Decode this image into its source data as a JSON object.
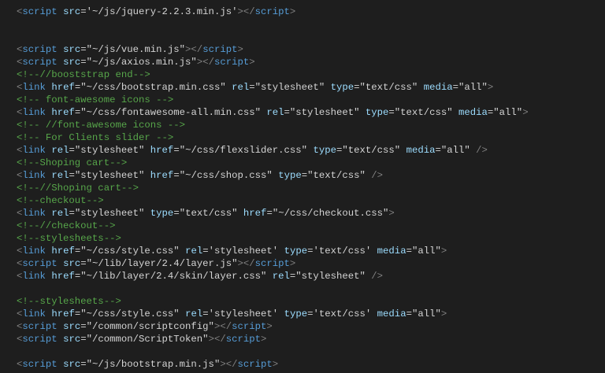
{
  "editor": {
    "colors": {
      "background": "#1e1e1e",
      "delimiter": "#808080",
      "tag": "#569cd6",
      "attribute": "#9cdcfe",
      "value": "#d4d4d4",
      "comment": "#57a64a"
    },
    "lines": [
      [
        [
          "d",
          "<"
        ],
        [
          "t",
          "script"
        ],
        [
          "p",
          " "
        ],
        [
          "a",
          "src"
        ],
        [
          "p",
          "="
        ],
        [
          "v",
          "'~/js/jquery-2.2.3.min.js'"
        ],
        [
          "d",
          "></"
        ],
        [
          "t",
          "script"
        ],
        [
          "d",
          ">"
        ]
      ],
      [],
      [],
      [
        [
          "d",
          "<"
        ],
        [
          "t",
          "script"
        ],
        [
          "p",
          " "
        ],
        [
          "a",
          "src"
        ],
        [
          "p",
          "="
        ],
        [
          "v",
          "\"~/js/vue.min.js\""
        ],
        [
          "d",
          "></"
        ],
        [
          "t",
          "script"
        ],
        [
          "d",
          ">"
        ]
      ],
      [
        [
          "d",
          "<"
        ],
        [
          "t",
          "script"
        ],
        [
          "p",
          " "
        ],
        [
          "a",
          "src"
        ],
        [
          "p",
          "="
        ],
        [
          "v",
          "\"~/js/axios.min.js\""
        ],
        [
          "d",
          "></"
        ],
        [
          "t",
          "script"
        ],
        [
          "d",
          ">"
        ]
      ],
      [
        [
          "c",
          "<!--//booststrap end-->"
        ]
      ],
      [
        [
          "d",
          "<"
        ],
        [
          "t",
          "link"
        ],
        [
          "p",
          " "
        ],
        [
          "a",
          "href"
        ],
        [
          "p",
          "="
        ],
        [
          "v",
          "\"~/css/bootstrap.min.css\""
        ],
        [
          "p",
          " "
        ],
        [
          "a",
          "rel"
        ],
        [
          "p",
          "="
        ],
        [
          "v",
          "\"stylesheet\""
        ],
        [
          "p",
          " "
        ],
        [
          "a",
          "type"
        ],
        [
          "p",
          "="
        ],
        [
          "v",
          "\"text/css\""
        ],
        [
          "p",
          " "
        ],
        [
          "a",
          "media"
        ],
        [
          "p",
          "="
        ],
        [
          "v",
          "\"all\""
        ],
        [
          "d",
          ">"
        ]
      ],
      [
        [
          "c",
          "<!-- font-awesome icons -->"
        ]
      ],
      [
        [
          "d",
          "<"
        ],
        [
          "t",
          "link"
        ],
        [
          "p",
          " "
        ],
        [
          "a",
          "href"
        ],
        [
          "p",
          "="
        ],
        [
          "v",
          "\"~/css/fontawesome-all.min.css\""
        ],
        [
          "p",
          " "
        ],
        [
          "a",
          "rel"
        ],
        [
          "p",
          "="
        ],
        [
          "v",
          "\"stylesheet\""
        ],
        [
          "p",
          " "
        ],
        [
          "a",
          "type"
        ],
        [
          "p",
          "="
        ],
        [
          "v",
          "\"text/css\""
        ],
        [
          "p",
          " "
        ],
        [
          "a",
          "media"
        ],
        [
          "p",
          "="
        ],
        [
          "v",
          "\"all\""
        ],
        [
          "d",
          ">"
        ]
      ],
      [
        [
          "c",
          "<!-- //font-awesome icons -->"
        ]
      ],
      [
        [
          "c",
          "<!-- For Clients slider -->"
        ]
      ],
      [
        [
          "d",
          "<"
        ],
        [
          "t",
          "link"
        ],
        [
          "p",
          " "
        ],
        [
          "a",
          "rel"
        ],
        [
          "p",
          "="
        ],
        [
          "v",
          "\"stylesheet\""
        ],
        [
          "p",
          " "
        ],
        [
          "a",
          "href"
        ],
        [
          "p",
          "="
        ],
        [
          "v",
          "\"~/css/flexslider.css\""
        ],
        [
          "p",
          " "
        ],
        [
          "a",
          "type"
        ],
        [
          "p",
          "="
        ],
        [
          "v",
          "\"text/css\""
        ],
        [
          "p",
          " "
        ],
        [
          "a",
          "media"
        ],
        [
          "p",
          "="
        ],
        [
          "v",
          "\"all\""
        ],
        [
          "p",
          " "
        ],
        [
          "d",
          "/>"
        ]
      ],
      [
        [
          "c",
          "<!--Shoping cart-->"
        ]
      ],
      [
        [
          "d",
          "<"
        ],
        [
          "t",
          "link"
        ],
        [
          "p",
          " "
        ],
        [
          "a",
          "rel"
        ],
        [
          "p",
          "="
        ],
        [
          "v",
          "\"stylesheet\""
        ],
        [
          "p",
          " "
        ],
        [
          "a",
          "href"
        ],
        [
          "p",
          "="
        ],
        [
          "v",
          "\"~/css/shop.css\""
        ],
        [
          "p",
          " "
        ],
        [
          "a",
          "type"
        ],
        [
          "p",
          "="
        ],
        [
          "v",
          "\"text/css\""
        ],
        [
          "p",
          " "
        ],
        [
          "d",
          "/>"
        ]
      ],
      [
        [
          "c",
          "<!--//Shoping cart-->"
        ]
      ],
      [
        [
          "c",
          "<!--checkout-->"
        ]
      ],
      [
        [
          "d",
          "<"
        ],
        [
          "t",
          "link"
        ],
        [
          "p",
          " "
        ],
        [
          "a",
          "rel"
        ],
        [
          "p",
          "="
        ],
        [
          "v",
          "\"stylesheet\""
        ],
        [
          "p",
          " "
        ],
        [
          "a",
          "type"
        ],
        [
          "p",
          "="
        ],
        [
          "v",
          "\"text/css\""
        ],
        [
          "p",
          " "
        ],
        [
          "a",
          "href"
        ],
        [
          "p",
          "="
        ],
        [
          "v",
          "\"~/css/checkout.css\""
        ],
        [
          "d",
          ">"
        ]
      ],
      [
        [
          "c",
          "<!--//checkout-->"
        ]
      ],
      [
        [
          "c",
          "<!--stylesheets-->"
        ]
      ],
      [
        [
          "d",
          "<"
        ],
        [
          "t",
          "link"
        ],
        [
          "p",
          " "
        ],
        [
          "a",
          "href"
        ],
        [
          "p",
          "="
        ],
        [
          "v",
          "\"~/css/style.css\""
        ],
        [
          "p",
          " "
        ],
        [
          "a",
          "rel"
        ],
        [
          "p",
          "="
        ],
        [
          "v",
          "'stylesheet'"
        ],
        [
          "p",
          " "
        ],
        [
          "a",
          "type"
        ],
        [
          "p",
          "="
        ],
        [
          "v",
          "'text/css'"
        ],
        [
          "p",
          " "
        ],
        [
          "a",
          "media"
        ],
        [
          "p",
          "="
        ],
        [
          "v",
          "\"all\""
        ],
        [
          "d",
          ">"
        ]
      ],
      [
        [
          "d",
          "<"
        ],
        [
          "t",
          "script"
        ],
        [
          "p",
          " "
        ],
        [
          "a",
          "src"
        ],
        [
          "p",
          "="
        ],
        [
          "v",
          "\"~/lib/layer/2.4/layer.js\""
        ],
        [
          "d",
          "></"
        ],
        [
          "t",
          "script"
        ],
        [
          "d",
          ">"
        ]
      ],
      [
        [
          "d",
          "<"
        ],
        [
          "t",
          "link"
        ],
        [
          "p",
          " "
        ],
        [
          "a",
          "href"
        ],
        [
          "p",
          "="
        ],
        [
          "v",
          "\"~/lib/layer/2.4/skin/layer.css\""
        ],
        [
          "p",
          " "
        ],
        [
          "a",
          "rel"
        ],
        [
          "p",
          "="
        ],
        [
          "v",
          "\"stylesheet\""
        ],
        [
          "p",
          " "
        ],
        [
          "d",
          "/>"
        ]
      ],
      [],
      [
        [
          "c",
          "<!--stylesheets-->"
        ]
      ],
      [
        [
          "d",
          "<"
        ],
        [
          "t",
          "link"
        ],
        [
          "p",
          " "
        ],
        [
          "a",
          "href"
        ],
        [
          "p",
          "="
        ],
        [
          "v",
          "\"~/css/style.css\""
        ],
        [
          "p",
          " "
        ],
        [
          "a",
          "rel"
        ],
        [
          "p",
          "="
        ],
        [
          "v",
          "'stylesheet'"
        ],
        [
          "p",
          " "
        ],
        [
          "a",
          "type"
        ],
        [
          "p",
          "="
        ],
        [
          "v",
          "'text/css'"
        ],
        [
          "p",
          " "
        ],
        [
          "a",
          "media"
        ],
        [
          "p",
          "="
        ],
        [
          "v",
          "\"all\""
        ],
        [
          "d",
          ">"
        ]
      ],
      [
        [
          "d",
          "<"
        ],
        [
          "t",
          "script"
        ],
        [
          "p",
          " "
        ],
        [
          "a",
          "src"
        ],
        [
          "p",
          "="
        ],
        [
          "v",
          "\"/common/scriptconfig\""
        ],
        [
          "d",
          "></"
        ],
        [
          "t",
          "script"
        ],
        [
          "d",
          ">"
        ]
      ],
      [
        [
          "d",
          "<"
        ],
        [
          "t",
          "script"
        ],
        [
          "p",
          " "
        ],
        [
          "a",
          "src"
        ],
        [
          "p",
          "="
        ],
        [
          "v",
          "\"/common/ScriptToken\""
        ],
        [
          "d",
          "></"
        ],
        [
          "t",
          "script"
        ],
        [
          "d",
          ">"
        ]
      ],
      [],
      [
        [
          "d",
          "<"
        ],
        [
          "t",
          "script"
        ],
        [
          "p",
          " "
        ],
        [
          "a",
          "src"
        ],
        [
          "p",
          "="
        ],
        [
          "v",
          "\"~/js/bootstrap.min.js\""
        ],
        [
          "d",
          "></"
        ],
        [
          "t",
          "script"
        ],
        [
          "d",
          ">"
        ]
      ]
    ]
  }
}
